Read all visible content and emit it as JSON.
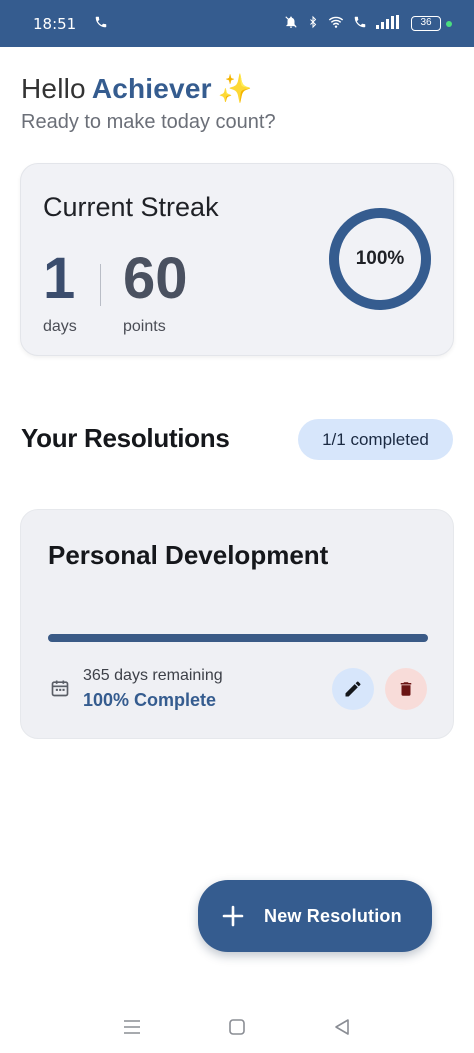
{
  "status_bar": {
    "time": "18:51",
    "battery": "36"
  },
  "greeting": {
    "hello": "Hello",
    "name": "Achiever",
    "emoji": "✨",
    "subtitle": "Ready to make today count?"
  },
  "streak": {
    "title": "Current Streak",
    "days_value": "1",
    "days_label": "days",
    "points_value": "60",
    "points_label": "points",
    "progress_label": "100%",
    "progress_fraction": 1.0
  },
  "resolutions": {
    "title": "Your Resolutions",
    "completed_badge": "1/1 completed",
    "items": [
      {
        "title": "Personal Development",
        "progress_fraction": 1.0,
        "remaining": "365 days remaining",
        "complete_label": "100% Complete"
      }
    ]
  },
  "fab": {
    "label": "New Resolution"
  },
  "colors": {
    "primary": "#355c8f",
    "pill_bg": "#d7e6fb",
    "danger_bg": "#f8dcd9",
    "card_bg": "#f1f2f6"
  }
}
